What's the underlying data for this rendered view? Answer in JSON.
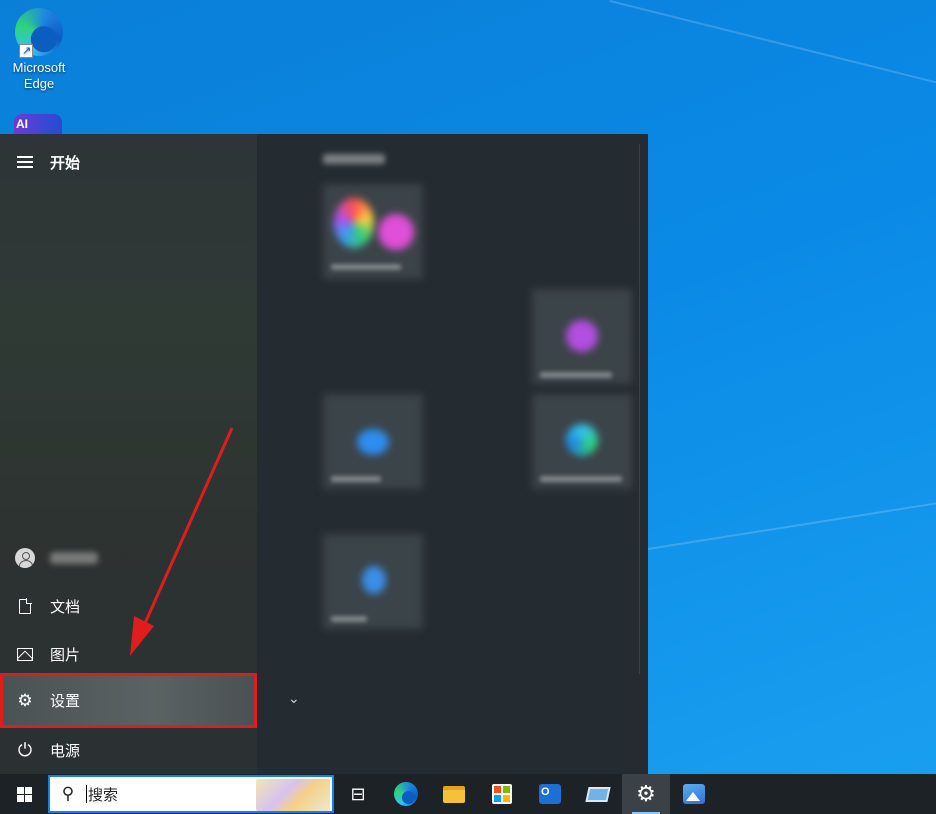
{
  "desktop": {
    "icons": [
      {
        "label": "Microsoft\nEdge",
        "line1": "Microsoft",
        "line2": "Edge",
        "icon": "edge-icon"
      },
      {
        "label": "AI",
        "icon": "ai-app-icon"
      }
    ]
  },
  "start_menu": {
    "title": "开始",
    "user_name_blurred": true,
    "items": [
      {
        "label": "文档",
        "icon": "document-icon"
      },
      {
        "label": "图片",
        "icon": "pictures-icon"
      },
      {
        "label": "设置",
        "icon": "gear-icon",
        "highlighted": true
      },
      {
        "label": "电源",
        "icon": "power-icon"
      }
    ],
    "expand_chevron": "⌄"
  },
  "annotation": {
    "color": "#e01d1d"
  },
  "taskbar": {
    "search_placeholder": "搜索",
    "icons": [
      "windows-start-icon",
      "task-view-icon",
      "edge-icon",
      "file-explorer-icon",
      "microsoft-store-icon",
      "outlook-icon",
      "this-pc-icon",
      "settings-icon",
      "photos-icon"
    ]
  }
}
